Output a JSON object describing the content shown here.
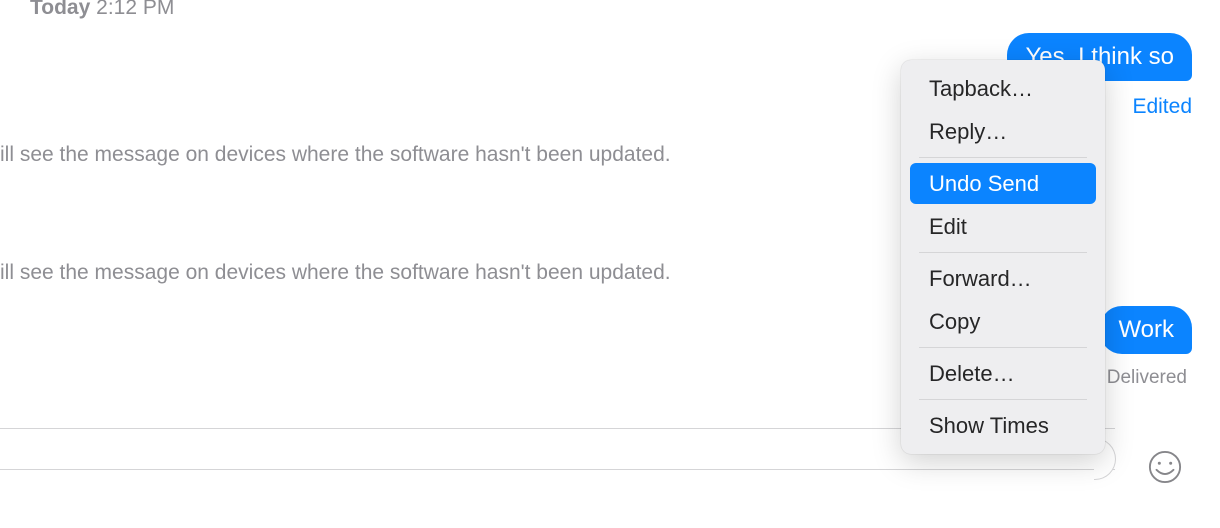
{
  "timestamp": {
    "day": "Today",
    "time": "2:12 PM"
  },
  "system_messages": [
    "ill see the message on devices where the software hasn't been updated.",
    "ill see the message on devices where the software hasn't been updated."
  ],
  "sent_messages": [
    {
      "text": "Yes, I think so",
      "status": "Edited"
    },
    {
      "text": "Work",
      "status": "Delivered"
    }
  ],
  "context_menu": {
    "groups": [
      [
        "Tapback…",
        "Reply…"
      ],
      [
        "Undo Send",
        "Edit"
      ],
      [
        "Forward…",
        "Copy"
      ],
      [
        "Delete…"
      ],
      [
        "Show Times"
      ]
    ],
    "highlighted": "Undo Send"
  }
}
